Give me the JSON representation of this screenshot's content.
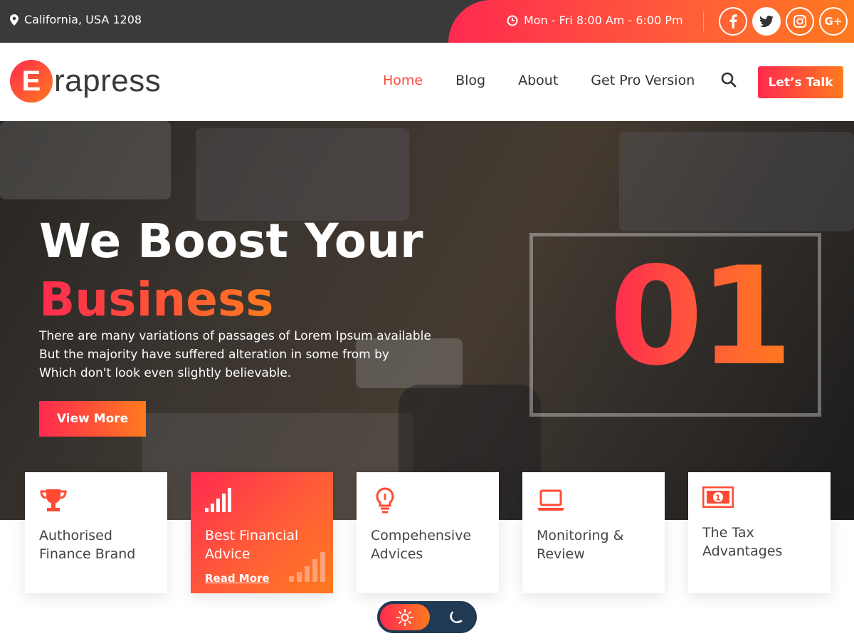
{
  "topbar": {
    "location": "California, USA 1208",
    "hours": "Mon - Fri 8:00 Am - 6:00 Pm",
    "socials": [
      {
        "icon": "facebook-icon",
        "label": "f"
      },
      {
        "icon": "twitter-icon",
        "label": "t"
      },
      {
        "icon": "instagram-icon",
        "label": "ig"
      },
      {
        "icon": "google-plus-icon",
        "label": "G+"
      }
    ]
  },
  "header": {
    "logo_letter": "E",
    "logo_text": "rapress",
    "nav": [
      "Home",
      "Blog",
      "About",
      "Get Pro Version"
    ],
    "cta": "Let’s Talk"
  },
  "hero": {
    "title_line1": "We Boost Your",
    "title_line2": "Business",
    "description": [
      "There are many variations of passages of Lorem Ipsum available",
      "But the majority have suffered alteration in some from by",
      "Which don't look even slightly believable."
    ],
    "button": "View More",
    "slide_number": "01"
  },
  "features": [
    {
      "icon": "trophy-icon",
      "title": "Authorised Finance Brand"
    },
    {
      "icon": "bar-chart-icon",
      "title": "Best Financial Advice",
      "link": "Read More"
    },
    {
      "icon": "lightbulb-icon",
      "title": "Compehensive Advices"
    },
    {
      "icon": "laptop-icon",
      "title": "Monitoring & Review"
    },
    {
      "icon": "money-icon",
      "title": "The Tax Advantages"
    }
  ],
  "colors": {
    "accent_start": "#ff2a4f",
    "accent_end": "#ff7a1f",
    "topbar_bg": "#3a3a3a",
    "toggle_bg": "#1f3a52"
  }
}
